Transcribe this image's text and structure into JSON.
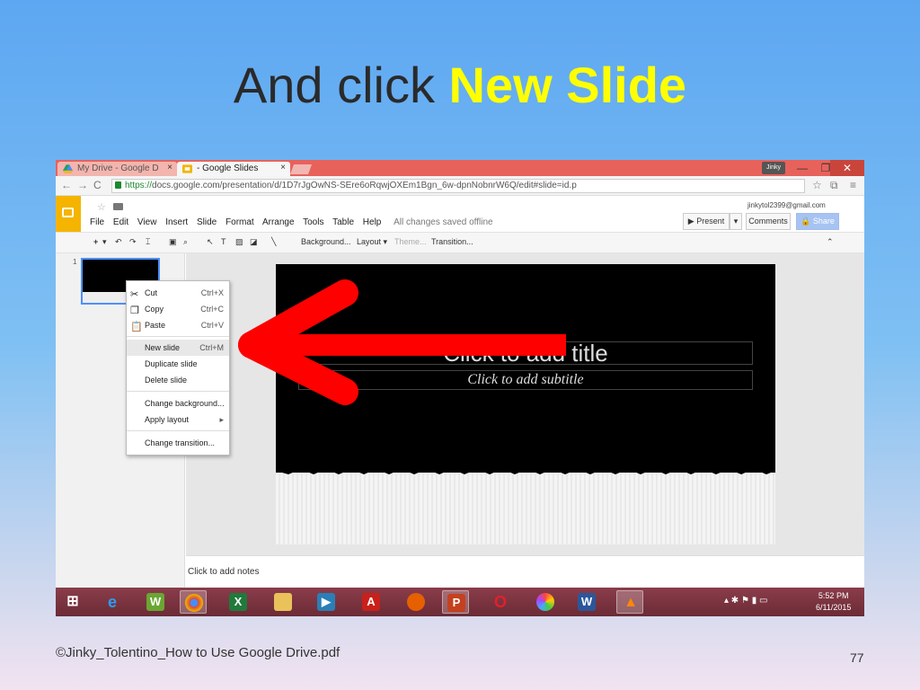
{
  "slide": {
    "title_prefix": "And click ",
    "title_highlight": "New Slide",
    "footer_credit": "©Jinky_Tolentino_How to Use Google Drive.pdf",
    "page_number": "77"
  },
  "browser": {
    "tabs": [
      {
        "label": "My Drive - Google D"
      },
      {
        "label": "- Google Slides"
      }
    ],
    "user_chip": "Jinky",
    "url_scheme": "https://",
    "url_rest": "docs.google.com/presentation/d/1D7rJgOwNS-SEre6oRqwjOXEm1Bgn_6w-dpnNobnrW6Q/edit#slide=id.p"
  },
  "app": {
    "account_email": "jinkytol2399@gmail.com",
    "menu": [
      "File",
      "Edit",
      "View",
      "Insert",
      "Slide",
      "Format",
      "Arrange",
      "Tools",
      "Table",
      "Help"
    ],
    "save_status": "All changes saved offline",
    "present_label": "Present",
    "comments_label": "Comments",
    "share_label": "Share",
    "share_color": "#a7c3f2",
    "toolbar": {
      "background": "Background...",
      "layout": "Layout",
      "theme": "Theme...",
      "transition": "Transition..."
    }
  },
  "filmstrip": {
    "slide_number": "1"
  },
  "canvas": {
    "title_placeholder": "Click to add title",
    "subtitle_placeholder": "Click to add subtitle",
    "notes_placeholder": "Click to add notes"
  },
  "context_menu": {
    "items": [
      {
        "label": "Cut",
        "shortcut": "Ctrl+X",
        "icon": "scissors-icon"
      },
      {
        "label": "Copy",
        "shortcut": "Ctrl+C",
        "icon": "copy-icon"
      },
      {
        "label": "Paste",
        "shortcut": "Ctrl+V",
        "icon": "paste-icon"
      },
      {
        "label": "New slide",
        "shortcut": "Ctrl+M"
      },
      {
        "label": "Duplicate slide"
      },
      {
        "label": "Delete slide"
      },
      {
        "label": "Change background..."
      },
      {
        "label": "Apply layout",
        "submenu": "▸"
      },
      {
        "label": "Change transition..."
      }
    ]
  },
  "taskbar": {
    "time": "5:52 PM",
    "date": "6/11/2015",
    "annotation_arrow_color": "#ff0000"
  }
}
